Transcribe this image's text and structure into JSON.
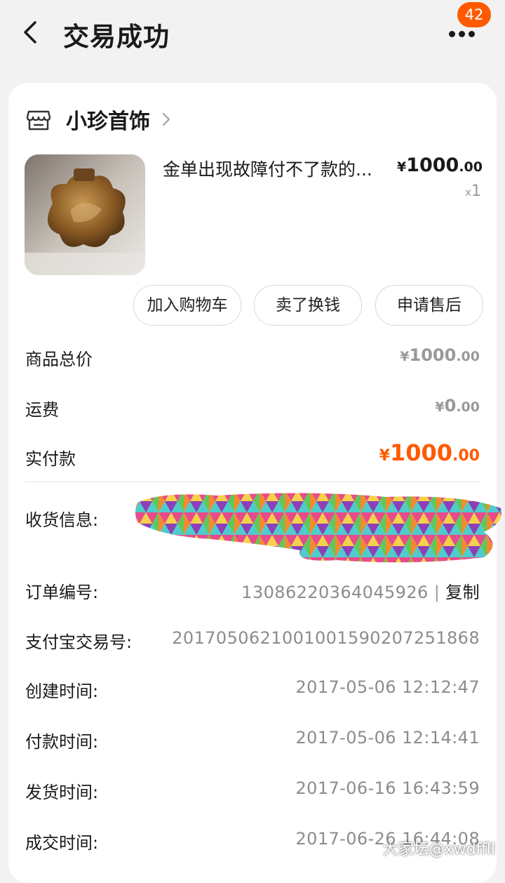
{
  "header": {
    "title": "交易成功",
    "badge_count": "42"
  },
  "shop": {
    "name": "小珍首饰"
  },
  "product": {
    "name": "金单出现故障付不了款的...",
    "price_currency": "¥",
    "price_int": "1000",
    "price_dec": ".00",
    "qty_x": "x",
    "qty_n": "1"
  },
  "actions": {
    "add_cart": "加入购物车",
    "sell": "卖了换钱",
    "after_sale": "申请售后"
  },
  "summary": {
    "total_label": "商品总价",
    "total_currency": "¥",
    "total_int": "1000",
    "total_dec": ".00",
    "shipping_label": "运费",
    "shipping_currency": "¥",
    "shipping_int": "0",
    "shipping_dec": ".00",
    "paid_label": "实付款",
    "paid_currency": "¥",
    "paid_int": "1000",
    "paid_dec": ".00"
  },
  "info": {
    "receiver_label": "收货信息:",
    "order_label": "订单编号:",
    "order_no": "13086220364045926",
    "copy_sep": "|",
    "copy_label": "复制",
    "alipay_label": "支付宝交易号:",
    "alipay_no": "2017050621001001590207251868",
    "created_label": "创建时间:",
    "created_time": "2017-05-06 12:12:47",
    "paid_label": "付款时间:",
    "paid_time": "2017-05-06 12:14:41",
    "shipped_label": "发货时间:",
    "shipped_time": "2017-06-16 16:43:59",
    "deal_label": "成交时间:",
    "deal_time": "2017-06-26 16:44:08"
  },
  "watermark": "大家坛@xwdffll",
  "colors": {
    "accent": "#ff5a00",
    "background": "#f2f2f2",
    "card": "#ffffff",
    "muted_text": "#999999"
  },
  "icons": [
    "back-arrow-icon",
    "more-dots-icon",
    "shop-icon",
    "chevron-right-icon"
  ]
}
